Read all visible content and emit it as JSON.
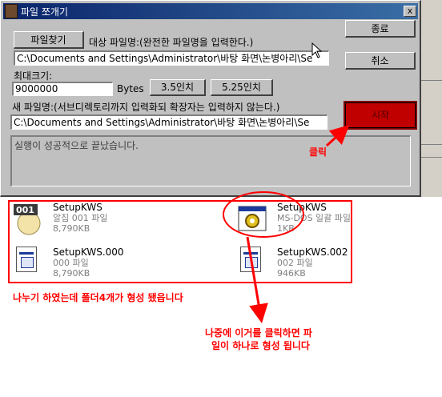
{
  "dialog": {
    "title": "파일 쪼개기",
    "close_label": "x",
    "find_file_label": "파일찾기",
    "target_file_label": "대상 파일명:(완전한 파일명을 입력한다.)",
    "target_file_value": "C:\\Documents and Settings\\Administrator\\바탕 화면\\논병아리\\Se",
    "max_size_label": "최대크기:",
    "max_size_value": "9000000",
    "bytes_label": "Bytes",
    "floppy_35_label": "3.5인치",
    "floppy_525_label": "5.25인치",
    "new_file_label": "새 파일명:(서브디렉토리까지 입력화되 확장자는 입력하지 않는다.)",
    "new_file_value": "C:\\Documents and Settings\\Administrator\\바탕 화면\\논병아리\\Se",
    "exit_label": "종료",
    "cancel_label": "취소",
    "start_label": "시작",
    "status_text": "실행이 성공적으로 끝났습니다."
  },
  "files": [
    {
      "name": "SetupKWS",
      "type": "알집 001 파일",
      "size": "8,790KB",
      "icon": "alzip-egg-icon"
    },
    {
      "name": "SetupKWS",
      "type": "MS-DOS 일괄 파일",
      "size": "1KB",
      "icon": "batch-gear-icon"
    },
    {
      "name": "SetupKWS.000",
      "type": "000 파일",
      "size": "8,790KB",
      "icon": "document-icon"
    },
    {
      "name": "SetupKWS.002",
      "type": "002 파일",
      "size": "946KB",
      "icon": "document-icon"
    }
  ],
  "annotations": {
    "click_note": "클릭",
    "folder_note": "나누기 하였는데 폴더4개가 형성 됐읍니다",
    "merge_note_line1": "나중에 이거를 클릭하면 파",
    "merge_note_line2": "일이 하나로 형성 됩니다"
  },
  "colors": {
    "annotation": "#ff0000",
    "start_button": "#c00000",
    "titlebar": "#0a246a"
  }
}
